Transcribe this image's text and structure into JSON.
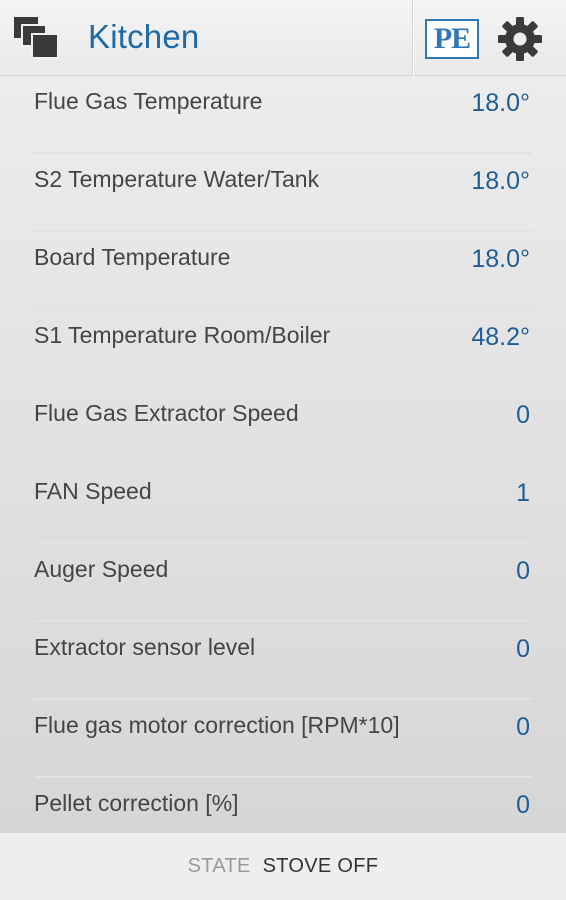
{
  "header": {
    "title": "Kitchen",
    "logo_text": "PE",
    "menu_icon": "windows-stack-icon",
    "settings_icon": "gear-icon",
    "accent_color": "#1f6aa6"
  },
  "readings": [
    {
      "label": "Flue Gas Temperature",
      "value": "18.0°"
    },
    {
      "label": "S2 Temperature Water/Tank",
      "value": "18.0°"
    },
    {
      "label": "Board Temperature",
      "value": "18.0°"
    },
    {
      "label": "S1 Temperature Room/Boiler",
      "value": "48.2°"
    },
    {
      "label": "Flue Gas Extractor Speed",
      "value": "0"
    },
    {
      "label": "FAN Speed",
      "value": "1"
    },
    {
      "label": "Auger Speed",
      "value": "0"
    },
    {
      "label": "Extractor sensor level",
      "value": "0"
    },
    {
      "label": "Flue gas motor correction [RPM*10]",
      "value": "0"
    },
    {
      "label": "Pellet correction [%]",
      "value": "0"
    }
  ],
  "footer": {
    "state_label": "STATE",
    "state_value": "STOVE OFF"
  }
}
